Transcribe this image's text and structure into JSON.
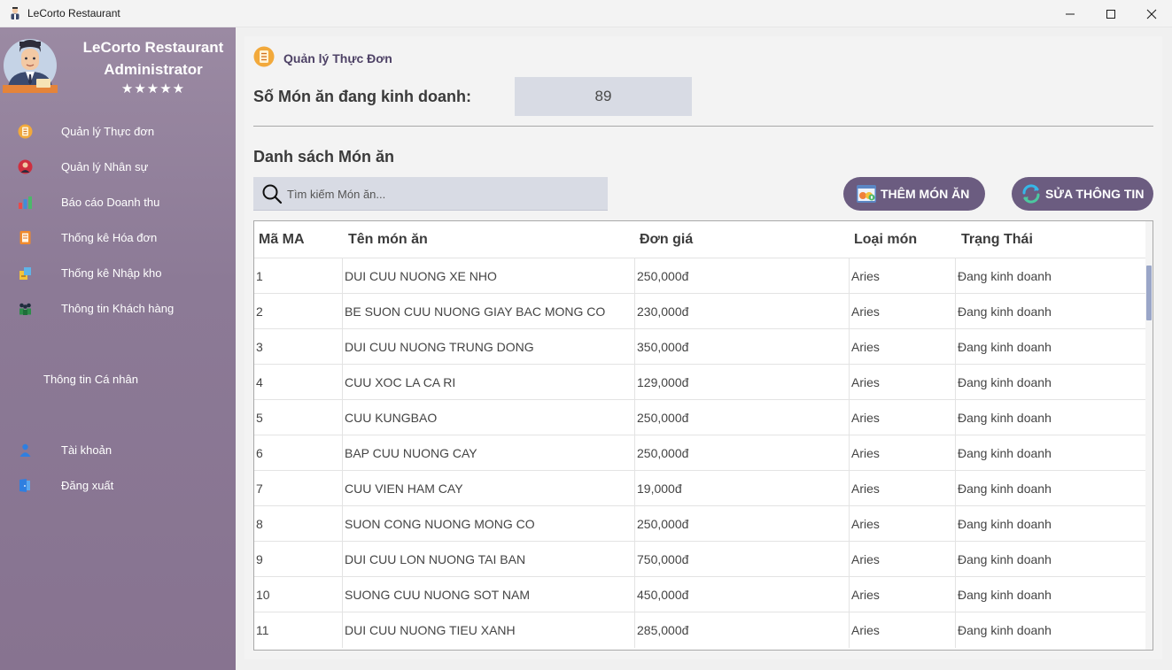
{
  "window": {
    "title": "LeCorto Restaurant"
  },
  "sidebar": {
    "brand_line1": "LeCorto Restaurant",
    "brand_line2": "Administrator",
    "stars": "★★★★★",
    "items": [
      {
        "label": "Quản lý Thực đơn",
        "icon": "menu-icon"
      },
      {
        "label": "Quản lý Nhân sự",
        "icon": "staff-icon"
      },
      {
        "label": "Báo cáo Doanh thu",
        "icon": "revenue-icon"
      },
      {
        "label": "Thống kê Hóa đơn",
        "icon": "invoice-icon"
      },
      {
        "label": "Thống kê Nhập kho",
        "icon": "warehouse-icon"
      },
      {
        "label": "Thông tin Khách hàng",
        "icon": "customers-icon"
      },
      {
        "label": "Thông tin Cá nhân",
        "icon": ""
      },
      {
        "label": "Tài khoản",
        "icon": "account-icon"
      },
      {
        "label": "Đăng xuất",
        "icon": "logout-icon"
      }
    ]
  },
  "main": {
    "page_title": "Quản lý Thực Đơn",
    "count_label": "Số Món ăn đang kinh doanh:",
    "count_value": "89",
    "list_title": "Danh sách Món ăn",
    "search_placeholder": "Tìm kiếm Món ăn...",
    "add_button": "THÊM MÓN ĂN",
    "edit_button": "SỬA THÔNG TIN"
  },
  "table": {
    "columns": [
      "Mã MA",
      "Tên món ăn",
      "Đơn giá",
      "Loại món",
      "Trạng Thái"
    ],
    "rows": [
      [
        "1",
        "DUI CUU NUONG XE NHO",
        "250,000đ",
        "Aries",
        "Đang kinh doanh"
      ],
      [
        "2",
        "BE SUON CUU NUONG GIAY BAC MONG CO",
        "230,000đ",
        "Aries",
        "Đang kinh doanh"
      ],
      [
        "3",
        "DUI CUU NUONG TRUNG DONG",
        "350,000đ",
        "Aries",
        "Đang kinh doanh"
      ],
      [
        "4",
        "CUU XOC LA CA RI",
        "129,000đ",
        "Aries",
        "Đang kinh doanh"
      ],
      [
        "5",
        "CUU KUNGBAO",
        "250,000đ",
        "Aries",
        "Đang kinh doanh"
      ],
      [
        "6",
        "BAP CUU NUONG CAY",
        "250,000đ",
        "Aries",
        "Đang kinh doanh"
      ],
      [
        "7",
        "CUU VIEN HAM CAY",
        "19,000đ",
        "Aries",
        "Đang kinh doanh"
      ],
      [
        "8",
        "SUON CONG NUONG MONG CO",
        "250,000đ",
        "Aries",
        "Đang kinh doanh"
      ],
      [
        "9",
        "DUI CUU LON NUONG TAI BAN",
        "750,000đ",
        "Aries",
        "Đang kinh doanh"
      ],
      [
        "10",
        "SUONG CUU NUONG SOT NAM",
        "450,000đ",
        "Aries",
        "Đang kinh doanh"
      ],
      [
        "11",
        "DUI CUU NUONG TIEU XANH",
        "285,000đ",
        "Aries",
        "Đang kinh doanh"
      ]
    ]
  }
}
